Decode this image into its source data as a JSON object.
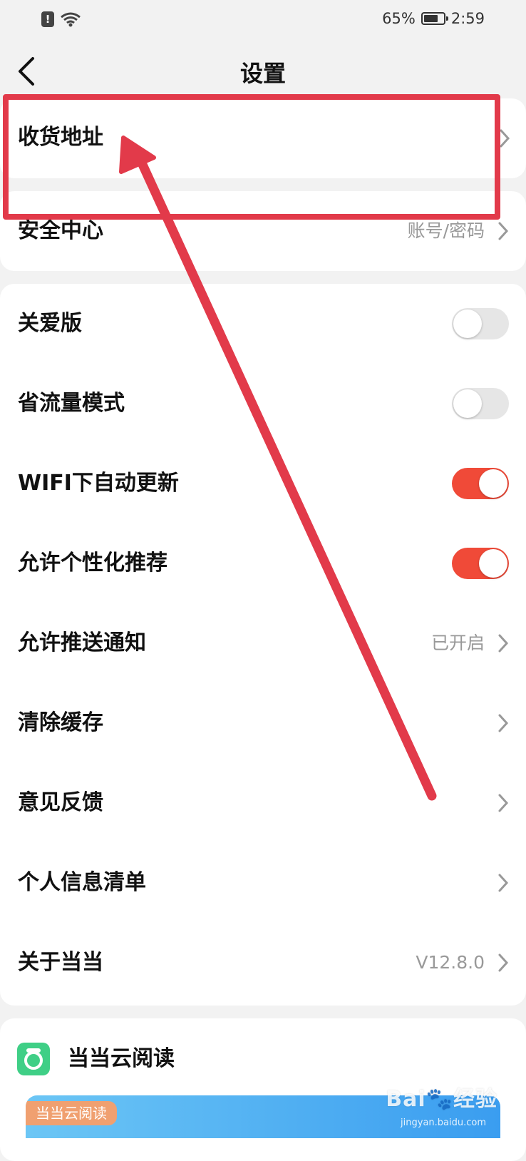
{
  "status_bar": {
    "battery": "65%",
    "time": "2:59",
    "icons": [
      "alert-icon",
      "wifi-icon",
      "battery-icon"
    ]
  },
  "nav": {
    "title": "设置",
    "back_icon": "chevron-left-icon"
  },
  "settings": {
    "shipping_address": {
      "label": "收货地址"
    },
    "security_center": {
      "label": "安全中心",
      "value": "账号/密码"
    },
    "care_version": {
      "label": "关爱版",
      "enabled": false
    },
    "data_saver": {
      "label": "省流量模式",
      "enabled": false
    },
    "wifi_auto_update": {
      "label": "WIFI下自动更新",
      "enabled": true
    },
    "personalized_recommend": {
      "label": "允许个性化推荐",
      "enabled": true
    },
    "push_notifications": {
      "label": "允许推送通知",
      "value": "已开启"
    },
    "clear_cache": {
      "label": "清除缓存"
    },
    "feedback": {
      "label": "意见反馈"
    },
    "personal_info_list": {
      "label": "个人信息清单"
    },
    "about": {
      "label": "关于当当",
      "value": "V12.8.0"
    }
  },
  "cloud_reading": {
    "label": "当当云阅读",
    "banner_tag": "当当云阅读",
    "icon": "cloud-reading-app-icon"
  },
  "annotation": {
    "color": "#e23a4a"
  },
  "colors": {
    "toggle_on": "#f04a38",
    "toggle_off": "#e6e6e6",
    "background": "#f2f2f2"
  }
}
